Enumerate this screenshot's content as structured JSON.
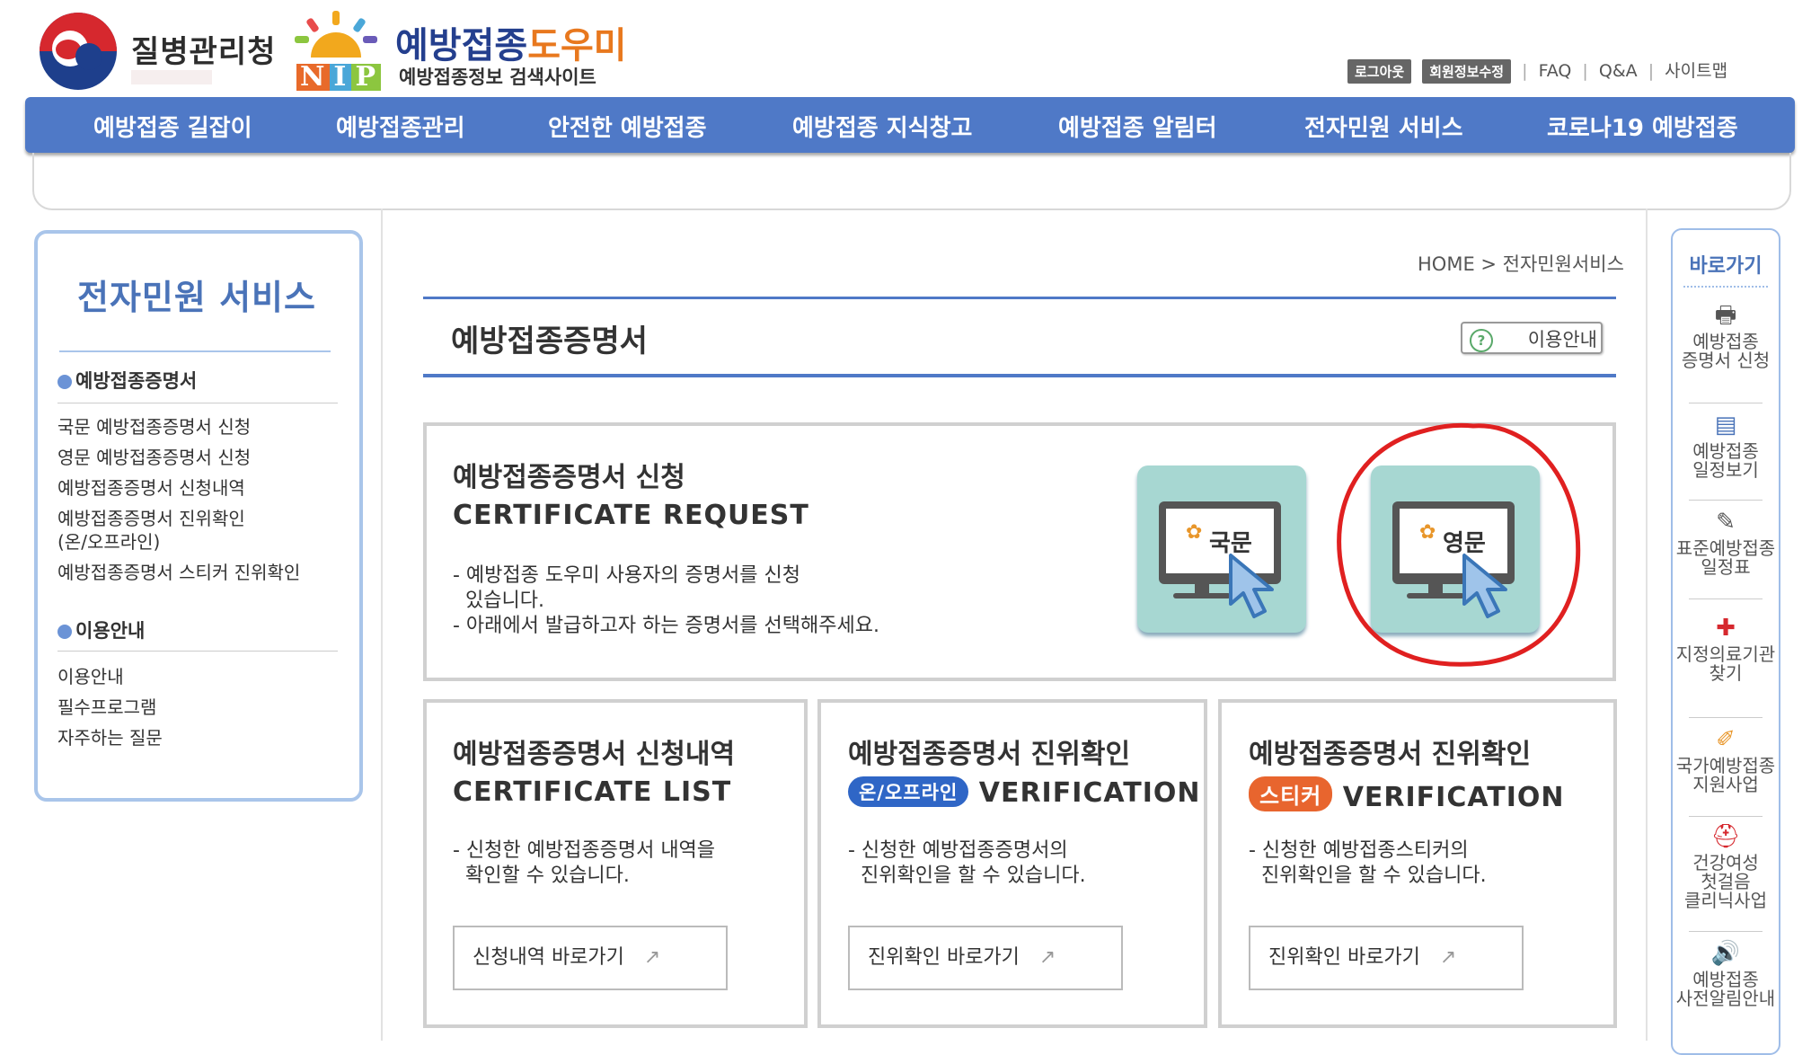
{
  "header": {
    "org_name": "질병관리청",
    "nip_letters": [
      "N",
      "I",
      "P"
    ],
    "site_name_part1": "예방접종",
    "site_name_part2": "도우미",
    "site_subtitle": "예방접종정보 검색사이트",
    "util": {
      "logout": "로그아웃",
      "edit_info": "회원정보수정",
      "faq": "FAQ",
      "qna": "Q&A",
      "sitemap": "사이트맵",
      "sep": "|"
    }
  },
  "nav": {
    "items": [
      "예방접종 길잡이",
      "예방접종관리",
      "안전한 예방접종",
      "예방접종 지식창고",
      "예방접종 알림터",
      "전자민원 서비스",
      "코로나19 예방접종"
    ]
  },
  "sidebar": {
    "title": "전자민원 서비스",
    "section1": "예방접종증명서",
    "section1_items": [
      "국문 예방접종증명서 신청",
      "영문 예방접종증명서 신청",
      "예방접종증명서 신청내역",
      "예방접종증명서 진위확인",
      "(온/오프라인)",
      "예방접종증명서 스티커 진위확인"
    ],
    "section2": "이용안내",
    "section2_items": [
      "이용안내",
      "필수프로그램",
      "자주하는 질문"
    ]
  },
  "content": {
    "breadcrumb": "HOME > 전자민원서비스",
    "page_title": "예방접종증명서",
    "guide_button": "이용안내",
    "request": {
      "title": "예방접종증명서 신청",
      "eng": "CERTIFICATE REQUEST",
      "desc1": "- 예방접종 도우미 사용자의 증명서를 신청",
      "desc2": "  있습니다.",
      "desc3": "- 아래에서 발급하고자 하는 증명서를 선택해주세요.",
      "korean_btn": "국문",
      "english_btn": "영문"
    },
    "list": {
      "title": "예방접종증명서 신청내역",
      "eng": "CERTIFICATE LIST",
      "desc1": "- 신청한 예방접종증명서 내역을",
      "desc2": "  확인할 수 있습니다.",
      "button": "신청내역 바로가기"
    },
    "verify_online": {
      "title": "예방접종증명서 진위확인",
      "pill": "온/오프라인",
      "eng": "VERIFICATION",
      "desc1": "- 신청한 예방접종증명서의",
      "desc2": "  진위확인을 할 수 있습니다.",
      "button": "진위확인 바로가기"
    },
    "verify_sticker": {
      "title": "예방접종증명서 진위확인",
      "pill": "스티커",
      "eng": "VERIFICATION",
      "desc1": "- 신청한 예방접종스티커의",
      "desc2": "  진위확인을 할 수 있습니다.",
      "button": "진위확인 바로가기"
    }
  },
  "quick_menu": {
    "title": "바로가기",
    "items": [
      {
        "l1": "예방접종",
        "l2": "증명서 신청",
        "icon": "printer-icon"
      },
      {
        "l1": "예방접종",
        "l2": "일정보기",
        "icon": "calendar-icon"
      },
      {
        "l1": "표준예방접종",
        "l2": "일정표",
        "icon": "syringe-icon"
      },
      {
        "l1": "지정의료기관",
        "l2": "찾기",
        "icon": "hospital-icon"
      },
      {
        "l1": "국가예방접종",
        "l2": "지원사업",
        "icon": "document-icon"
      },
      {
        "l1": "건강여성",
        "l2": "첫걸음",
        "l3": "클리닉사업",
        "icon": "first-aid-icon"
      },
      {
        "l1": "예방접종",
        "l2": "사전알림안내",
        "icon": "speaker-icon"
      }
    ]
  },
  "colors": {
    "nav": "#4f79c7",
    "sidebar_border": "#a9c5ea",
    "cert_button": "#a7d7d2",
    "online_pill": "#2f66c6",
    "sticker_pill": "#e8652e",
    "annotation": "#e02020"
  }
}
